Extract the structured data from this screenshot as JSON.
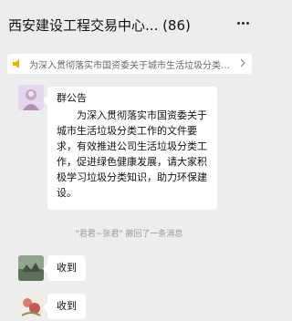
{
  "header": {
    "title": "西安建设工程交易中心... (86)",
    "menu_icon": "more-dots-icon"
  },
  "notice_bar": {
    "icon": "megaphone-icon",
    "text": "为深入贯彻落实市国资委关于城市生活垃圾分类工作的文件要求",
    "chevron": "chevron-right-icon"
  },
  "messages": [
    {
      "type": "group-notice",
      "title": "群公告",
      "body": "为深入贯彻落实市国资委关于城市生活垃圾分类工作的文件要求，有效推进公司生活垃圾分类工作，促进绿色健康发展，请大家积极学习垃圾分类知识，助力环保建设。"
    },
    {
      "type": "recall",
      "text": "\"君君~张君\" 撤回了一条消息"
    },
    {
      "type": "text",
      "text": "收到"
    },
    {
      "type": "text",
      "text": "收到"
    }
  ],
  "colors": {
    "background": "#ededed",
    "bubble": "#ffffff",
    "system_text": "#999999"
  }
}
